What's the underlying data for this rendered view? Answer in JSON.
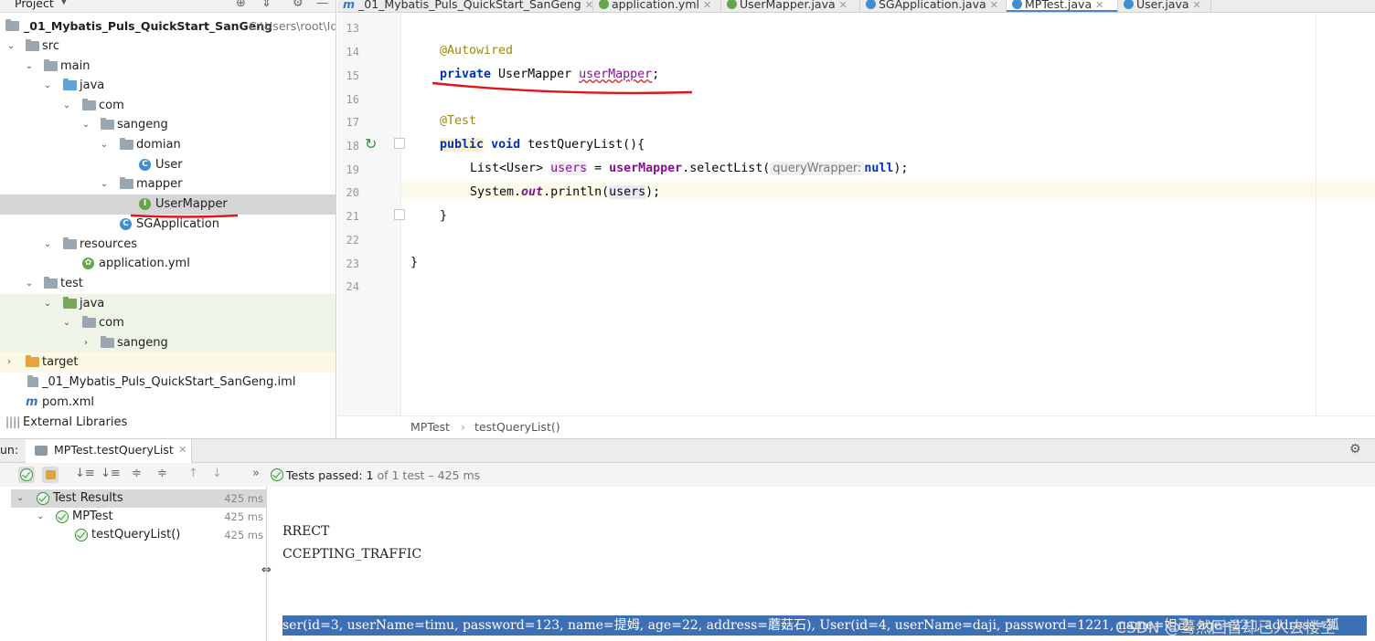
{
  "project": {
    "title": "Project",
    "root": "_01_Mybatis_Puls_QuickStart_SanGeng",
    "root_path": "C:\\Users\\root\\Id",
    "items": [
      {
        "label": "src"
      },
      {
        "label": "main"
      },
      {
        "label": "java"
      },
      {
        "label": "com"
      },
      {
        "label": "sangeng"
      },
      {
        "label": "domian"
      },
      {
        "label": "User"
      },
      {
        "label": "mapper"
      },
      {
        "label": "UserMapper"
      },
      {
        "label": "SGApplication"
      },
      {
        "label": "resources"
      },
      {
        "label": "application.yml"
      },
      {
        "label": "test"
      },
      {
        "label": "java"
      },
      {
        "label": "com"
      },
      {
        "label": "sangeng"
      },
      {
        "label": "target"
      },
      {
        "label": "_01_Mybatis_Puls_QuickStart_SanGeng.iml"
      },
      {
        "label": "pom.xml"
      },
      {
        "label": "External Libraries"
      }
    ]
  },
  "tabs": [
    {
      "label": "_01_Mybatis_Puls_QuickStart_SanGeng",
      "icon": "m"
    },
    {
      "label": "application.yml"
    },
    {
      "label": "UserMapper.java"
    },
    {
      "label": "SGApplication.java"
    },
    {
      "label": "MPTest.java",
      "active": true
    },
    {
      "label": "User.java"
    }
  ],
  "editor": {
    "line_numbers": [
      "13",
      "14",
      "15",
      "16",
      "17",
      "18",
      "19",
      "20",
      "21",
      "22",
      "23",
      "24"
    ],
    "code": {
      "l14_ann": "@Autowired",
      "l15_kw": "private",
      "l15_type": " UserMapper ",
      "l15_field": "userMapper",
      "l15_end": ";",
      "l17_ann": "@Test",
      "l18_kw1": "public",
      "l18_kw2": "void",
      "l18_rest": " testQueryList(){",
      "l19_a": "List<User> ",
      "l19_var": "users",
      "l19_b": " = ",
      "l19_field": "userMapper",
      "l19_c": ".selectList(",
      "l19_hint": "queryWrapper:",
      "l19_null": "null",
      "l19_end": ");",
      "l20_a": "System.",
      "l20_out": "out",
      "l20_b": ".println(",
      "l20_var": "users",
      "l20_end": ");",
      "l21": "}",
      "l23": "}"
    },
    "breadcrumb": [
      "MPTest",
      "testQueryList()"
    ]
  },
  "run": {
    "label": "un:",
    "tab": "MPTest.testQueryList",
    "status_prefix": "Tests passed:",
    "status_count": "1",
    "status_rest": "of 1 test – 425 ms",
    "results": [
      {
        "label": "Test Results",
        "time": "425 ms"
      },
      {
        "label": "MPTest",
        "time": "425 ms"
      },
      {
        "label": "testQueryList()",
        "time": "425 ms"
      }
    ],
    "console": [
      "RRECT",
      "CCEPTING_TRAFFIC"
    ],
    "selected_line": "ser(id=3, userName=timu, password=123, name=提姆, age=22, address=蘑菇石), User(id=4, userName=daji, password=1221, name=妲己, age=221, address=狐"
  },
  "watermark": "CSDN @蓦然回首却已人去楼空"
}
